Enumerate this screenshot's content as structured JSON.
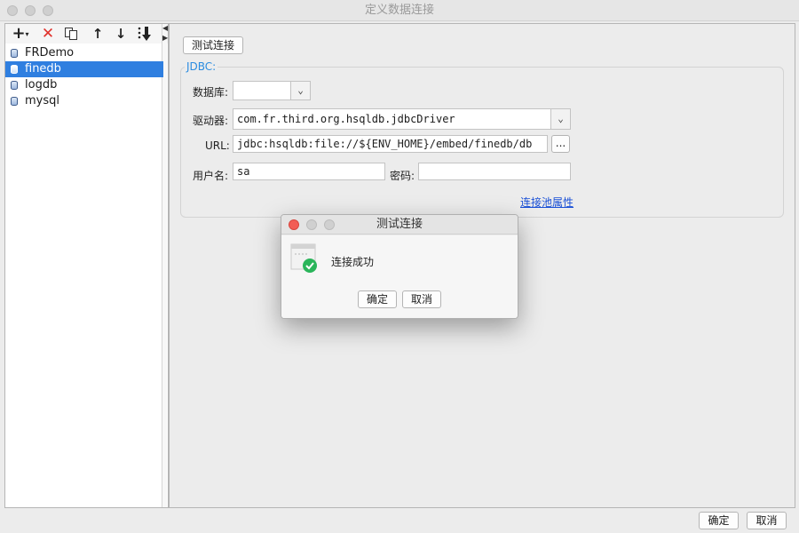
{
  "window": {
    "title": "定义数据连接"
  },
  "toolbar": {
    "add_icon": "plus-icon",
    "delete_icon": "red-x-icon",
    "copy_icon": "copy-icon",
    "move_up_icon": "arrow-up-icon",
    "move_down_icon": "arrow-down-icon",
    "sort_icon": "sort-down-icon"
  },
  "connections": [
    {
      "label": "FRDemo",
      "selected": false
    },
    {
      "label": "finedb",
      "selected": true
    },
    {
      "label": "logdb",
      "selected": false
    },
    {
      "label": "mysql",
      "selected": false
    }
  ],
  "form": {
    "test_button_label": "测试连接",
    "group_label": "JDBC:",
    "database_label": "数据库:",
    "database_value": "",
    "driver_label": "驱动器:",
    "driver_value": "com.fr.third.org.hsqldb.jdbcDriver",
    "url_label": "URL:",
    "url_value": "jdbc:hsqldb:file://${ENV_HOME}/embed/finedb/db",
    "url_browse_label": "...",
    "username_label": "用户名:",
    "username_value": "sa",
    "password_label": "密码:",
    "password_value": "",
    "pool_link_label": "连接池属性"
  },
  "dialog": {
    "title": "测试连接",
    "icon": "success-check-icon",
    "message": "连接成功",
    "ok_label": "确定",
    "cancel_label": "取消"
  },
  "footer": {
    "ok_label": "确定",
    "cancel_label": "取消"
  },
  "colors": {
    "selection": "#2f7fe0",
    "link": "#1a50d6",
    "group_title": "#2b8ce0",
    "success": "#2ab55a",
    "close_red": "#f25d55"
  }
}
